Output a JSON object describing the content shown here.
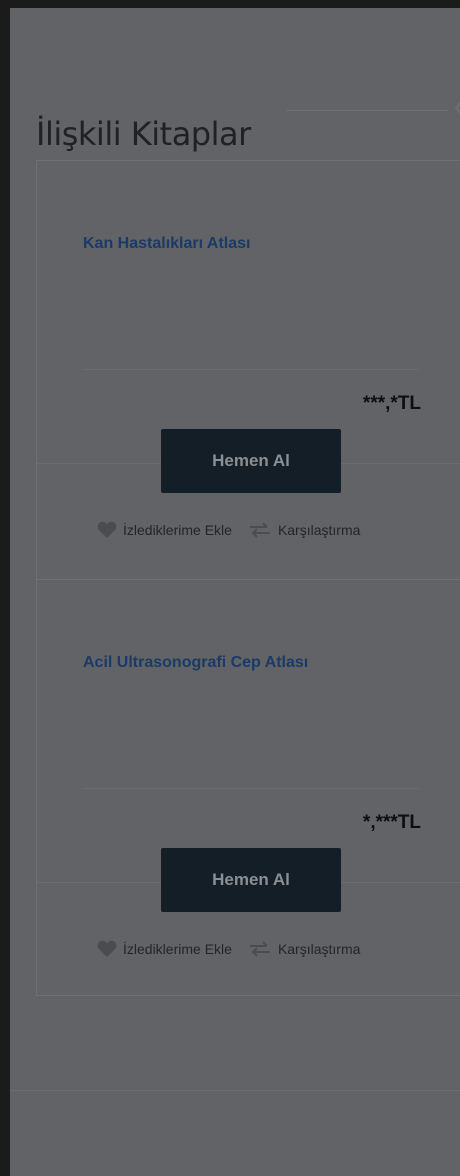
{
  "section": {
    "title": "İlişkili Kitaplar"
  },
  "products": [
    {
      "title": "Kan Hastalıkları Atlası",
      "price": "***,*TL",
      "buy_label": "Hemen Al",
      "watch_label": "İzlediklerime Ekle",
      "compare_label": "Karşılaştırma"
    },
    {
      "title": "Acil Ultrasonografi Cep Atlası",
      "price": "*,***TL",
      "buy_label": "Hemen Al",
      "watch_label": "İzlediklerime Ekle",
      "compare_label": "Karşılaştırma"
    }
  ],
  "icons": {
    "watch": "heart-icon",
    "compare": "swap-arrows-icon",
    "prev": "chevron-left-icon"
  },
  "colors": {
    "overlay_background": "#616366",
    "title_link": "#1c3a66",
    "button_background": "#141e26"
  }
}
